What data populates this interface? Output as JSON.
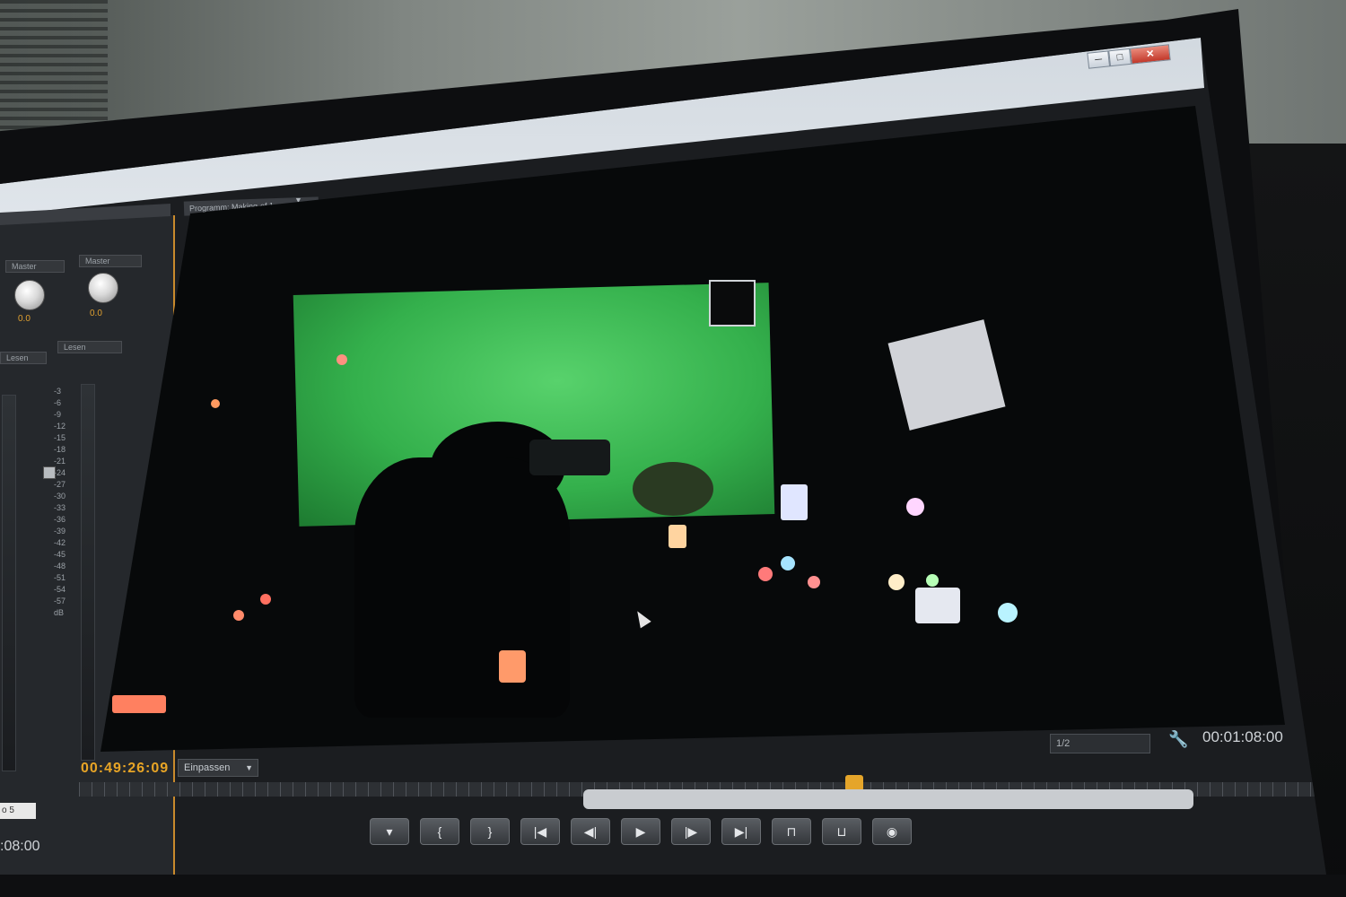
{
  "window": {
    "controls": {
      "minimize": "─",
      "maximize": "□",
      "close": "✕"
    }
  },
  "mixer": {
    "dropdowns": [
      "Master",
      "Master"
    ],
    "knob_values": [
      "0.0",
      "0.0"
    ],
    "channel_labels": [
      "Lesen",
      "Lesen"
    ],
    "meter_scale": [
      "-3",
      "-6",
      "-9",
      "-12",
      "-15",
      "-18",
      "-21",
      "-24",
      "-27",
      "-30",
      "-33",
      "-36",
      "-39",
      "-42",
      "-45",
      "-48",
      "-51",
      "-54",
      "-57"
    ],
    "unit": "dB",
    "track_name": "o 5",
    "timecode": ":08:00"
  },
  "program_monitor": {
    "tab_label": "Programm: Making-of 1",
    "timecode_current": "00:49:26:09",
    "fit_label": "Einpassen",
    "timecode_duration": "00:01:08:00",
    "quality_label": "1/2"
  },
  "transport": [
    {
      "name": "marker-button",
      "glyph": "▾"
    },
    {
      "name": "in-point-button",
      "glyph": "{"
    },
    {
      "name": "out-point-button",
      "glyph": "}"
    },
    {
      "name": "go-to-in-button",
      "glyph": "|◀"
    },
    {
      "name": "step-back-button",
      "glyph": "◀|"
    },
    {
      "name": "play-button",
      "glyph": "▶"
    },
    {
      "name": "step-forward-button",
      "glyph": "|▶"
    },
    {
      "name": "go-to-out-button",
      "glyph": "▶|"
    },
    {
      "name": "insert-button",
      "glyph": "⊓"
    },
    {
      "name": "overwrite-button",
      "glyph": "⊔"
    },
    {
      "name": "export-frame-button",
      "glyph": "◉"
    }
  ],
  "colors": {
    "accent": "#e8a526",
    "greenscreen": "#3fbf55"
  }
}
